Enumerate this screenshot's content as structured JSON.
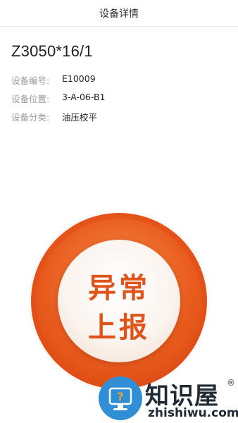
{
  "header": {
    "title": "设备详情"
  },
  "device": {
    "name": "Z3050*16/1",
    "fields": [
      {
        "label": "设备编号:",
        "value": "E10009"
      },
      {
        "label": "设备位置:",
        "value": "3-A-06-B1"
      },
      {
        "label": "设备分类:",
        "value": "油压校平"
      }
    ]
  },
  "report_button": {
    "line1": "异常",
    "line2": "上报"
  },
  "watermark": {
    "brand": "知识屋",
    "reg_mark": "®",
    "domain": "zhishiwu.com",
    "icon": "question-monitor-icon"
  }
}
